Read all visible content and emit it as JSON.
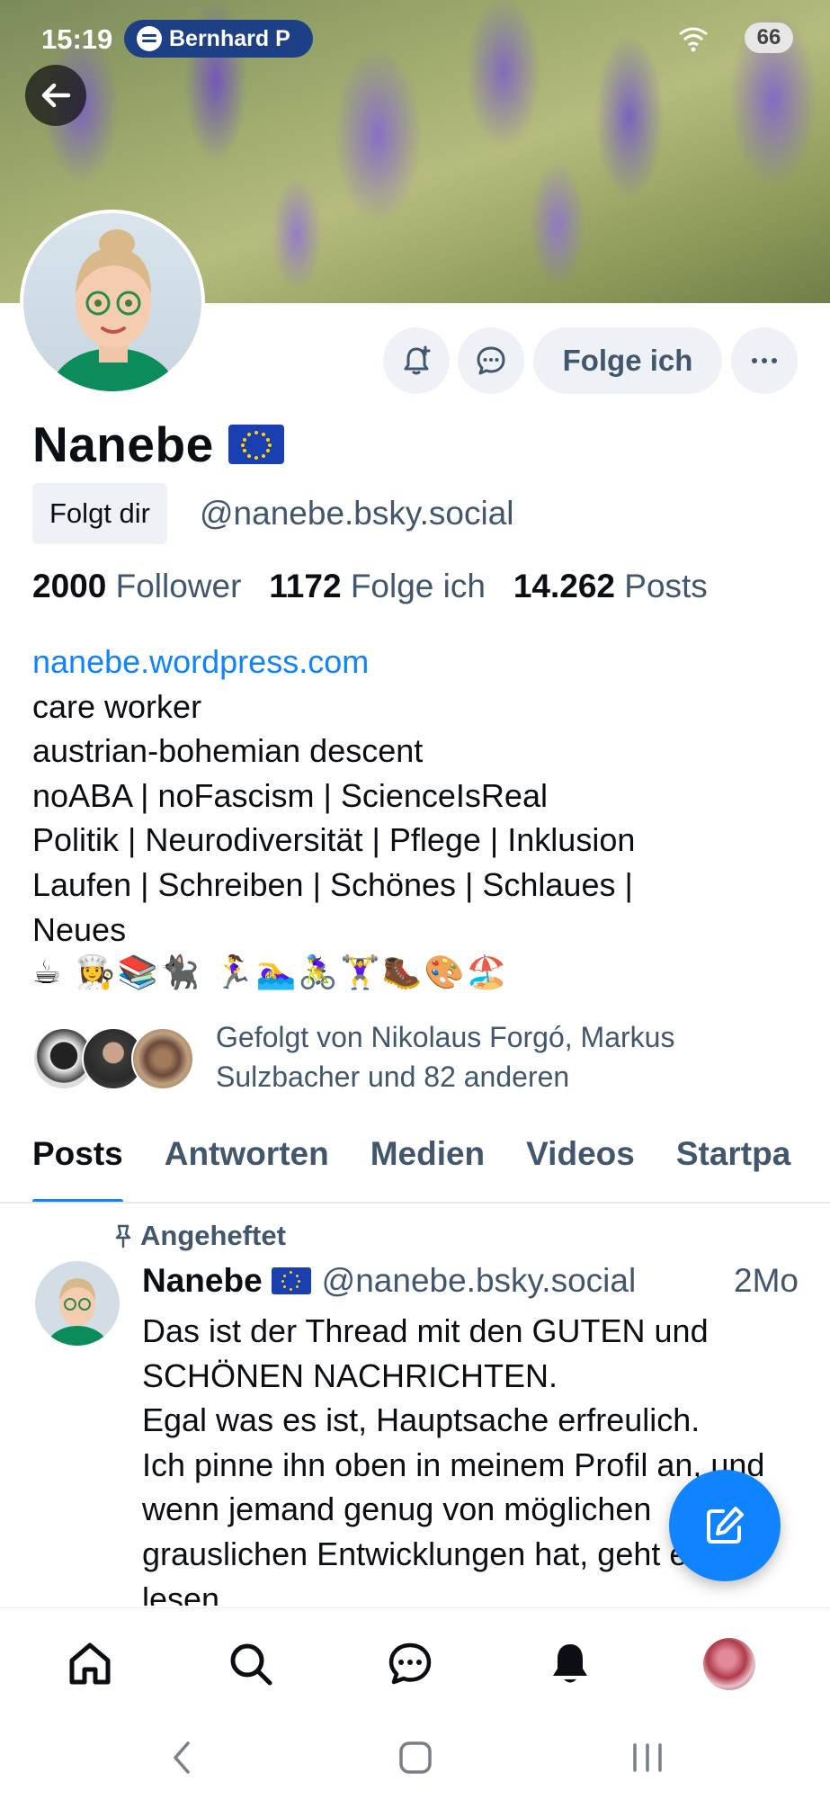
{
  "status_bar": {
    "time": "15:19",
    "media_label": "Bernhard P",
    "battery": "66"
  },
  "profile": {
    "name": "Nanebe",
    "follows_you": "Folgt dir",
    "handle": "@nanebe.bsky.social",
    "follow_button": "Folge ich",
    "stats": {
      "followers_count": "2000",
      "followers_label": "Follower",
      "following_count": "1172",
      "following_label": "Folge ich",
      "posts_count": "14.262",
      "posts_label": "Posts"
    },
    "bio": {
      "link": "nanebe.wordpress.com",
      "lines": [
        "care worker",
        "austrian-bohemian descent",
        "noABA | noFascism | ScienceIsReal",
        "Politik | Neurodiversität | Pflege | Inklusion",
        "Laufen | Schreiben | Schönes | Schlaues |",
        "Neues"
      ],
      "emojis": "☕ 👩‍🍳📚🐈‍⬛ 🏃‍♀️🏊‍♀️🚴‍♀️🏋️‍♀️🥾🎨🏖️"
    },
    "followed_by": "Gefolgt von Nikolaus Forgó, Markus Sulzbacher und 82 anderen"
  },
  "tabs": [
    "Posts",
    "Antworten",
    "Medien",
    "Videos",
    "Startpa"
  ],
  "post": {
    "pinned_label": "Angeheftet",
    "author": "Nanebe",
    "handle": "@nanebe.bsky.social",
    "time": "2Mo",
    "text": "Das ist der Thread mit den GUTEN und SCHÖNEN NACHRICHTEN.\nEgal was es ist, Hauptsache erfreulich.\nIch pinne ihn oben in meinem Profil an, und wenn jemand genug von möglichen grauslichen Entwicklungen hat, geht er dort lesen."
  },
  "colors": {
    "accent": "#1083fe",
    "text_primary": "#0b0f14",
    "text_secondary": "#42566e",
    "button_bg": "#eef2f6"
  }
}
